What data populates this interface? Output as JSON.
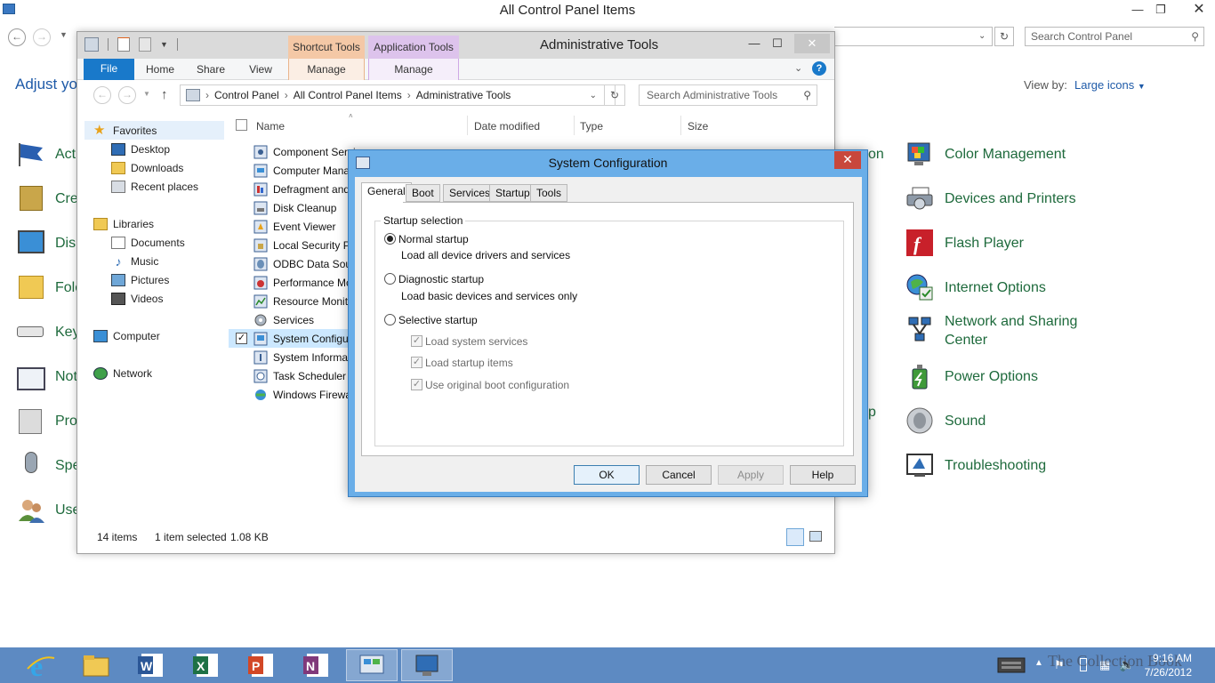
{
  "control_panel": {
    "title": "All Control Panel Items",
    "search_placeholder": "Search Control Panel",
    "heading": "Adjust you",
    "view_by_label": "View by:",
    "view_by_value": "Large icons",
    "left_stubs": [
      "Acti",
      "Cre",
      "Disp",
      "Folc",
      "Key",
      "Not",
      "Pro",
      "Spe",
      "Use"
    ],
    "middle_stubs": [
      "on",
      "p"
    ],
    "right_items": [
      {
        "label": "Color Management",
        "icon": "color-management-icon"
      },
      {
        "label": "Devices and Printers",
        "icon": "devices-printers-icon"
      },
      {
        "label": "Flash Player",
        "icon": "flash-player-icon"
      },
      {
        "label": "Internet Options",
        "icon": "internet-options-icon"
      },
      {
        "label": "Network and Sharing Center",
        "icon": "network-sharing-icon"
      },
      {
        "label": "Power Options",
        "icon": "power-options-icon"
      },
      {
        "label": "Sound",
        "icon": "sound-icon"
      },
      {
        "label": "Troubleshooting",
        "icon": "troubleshooting-icon"
      }
    ]
  },
  "explorer": {
    "title": "Administrative Tools",
    "context_tabs": [
      "Shortcut Tools",
      "Application Tools"
    ],
    "ribbon_tabs": [
      "File",
      "Home",
      "Share",
      "View",
      "Manage",
      "Manage"
    ],
    "breadcrumb": [
      "Control Panel",
      "All Control Panel Items",
      "Administrative Tools"
    ],
    "search_placeholder": "Search Administrative Tools",
    "nav": {
      "favorites": "Favorites",
      "favorites_items": [
        "Desktop",
        "Downloads",
        "Recent places"
      ],
      "libraries": "Libraries",
      "libraries_items": [
        "Documents",
        "Music",
        "Pictures",
        "Videos"
      ],
      "computer": "Computer",
      "network": "Network"
    },
    "columns": [
      "Name",
      "Date modified",
      "Type",
      "Size"
    ],
    "files": [
      "Component Servi",
      "Computer Mana",
      "Defragment and",
      "Disk Cleanup",
      "Event Viewer",
      "Local Security P",
      "ODBC Data Sour",
      "Performance Mc",
      "Resource Monit",
      "Services",
      "System Configu",
      "System Informat",
      "Task Scheduler",
      "Windows Firewa"
    ],
    "status": {
      "items": "14 items",
      "selected": "1 item selected",
      "size": "1.08 KB"
    }
  },
  "dialog": {
    "title": "System Configuration",
    "tabs": [
      "General",
      "Boot",
      "Services",
      "Startup",
      "Tools"
    ],
    "group_label": "Startup selection",
    "normal_label": "Normal startup",
    "normal_desc": "Load all device drivers and services",
    "diagnostic_label": "Diagnostic startup",
    "diagnostic_desc": "Load basic devices and services only",
    "selective_label": "Selective startup",
    "selective_options": [
      "Load system services",
      "Load startup items",
      "Use original boot configuration"
    ],
    "buttons": {
      "ok": "OK",
      "cancel": "Cancel",
      "apply": "Apply",
      "help": "Help"
    }
  },
  "taskbar": {
    "time": "9:16 AM",
    "date": "7/26/2012",
    "watermark": "The Collection Book"
  }
}
